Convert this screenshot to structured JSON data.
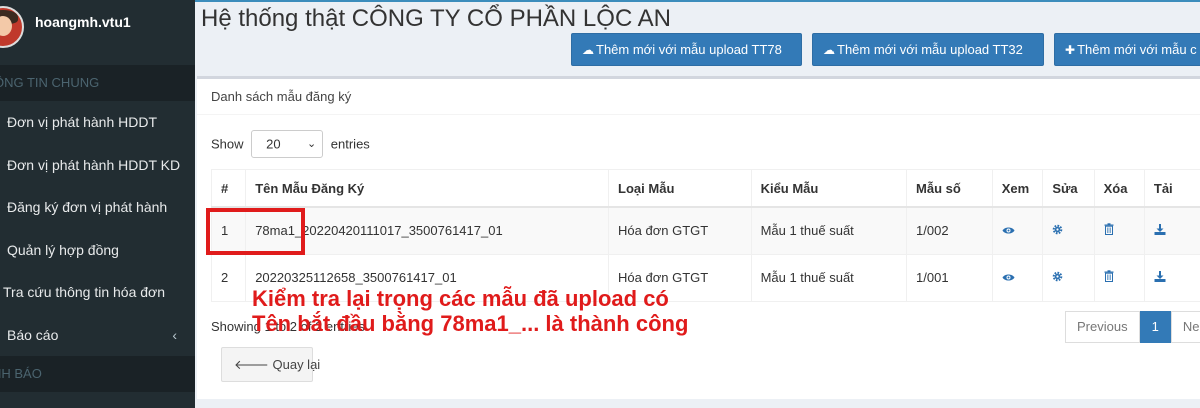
{
  "user": {
    "name": "hoangmh.vtu1"
  },
  "sidebar": {
    "section_general": "ÔNG TIN CHUNG",
    "items": [
      {
        "label": "Đơn vị phát hành HDDT"
      },
      {
        "label": "Đơn vị phát hành HDDT KD"
      },
      {
        "label": "Đăng ký đơn vị phát hành"
      },
      {
        "label": "Quản lý hợp đồng"
      },
      {
        "label": "Tra cứu thông tin hóa đơn"
      },
      {
        "label": "Báo cáo",
        "chevron": "chevron-left-icon"
      }
    ],
    "section_warning": "NH BÁO"
  },
  "page": {
    "title": "Hệ thống thật CÔNG TY CỔ PHẦN LỘC AN"
  },
  "toolbar": {
    "upload_tt78": "Thêm mới với mẫu upload TT78",
    "upload_tt32": "Thêm mới với mẫu upload TT32",
    "add_new": "Thêm mới với mẫu c"
  },
  "box": {
    "title": "Danh sách mẫu đăng ký",
    "show_label": "Show",
    "page_size": "20",
    "entries_label": "entries"
  },
  "table": {
    "headers": [
      "#",
      "Tên Mẫu Đăng Ký",
      "Loại Mẫu",
      "Kiểu Mẫu",
      "Mẫu số",
      "Xem",
      "Sửa",
      "Xóa",
      "Tải"
    ],
    "rows": [
      {
        "no": "1",
        "name": "78ma1_20220420111017_3500761417_01",
        "loai": "Hóa đơn GTGT",
        "kieu": "Mẫu 1 thuế suất",
        "mau_so": "1/002"
      },
      {
        "no": "2",
        "name": "20220325112658_3500761417_01",
        "loai": "Hóa đơn GTGT",
        "kieu": "Mẫu 1 thuế suất",
        "mau_so": "1/001"
      }
    ]
  },
  "footer": {
    "showing": "Showing 1 to 2 of 2 entries",
    "previous": "Previous",
    "page": "1",
    "next": "Ne",
    "back": "Quay lại"
  },
  "annotation": {
    "line1": "Kiểm tra lại trọng các mẫu đã upload có",
    "line2": "Tên bắt đầu bằng 78ma1_... là thành công"
  },
  "colors": {
    "sidebar_bg": "#222d32",
    "primary": "#337ab7",
    "annotation": "#e01b1b"
  }
}
